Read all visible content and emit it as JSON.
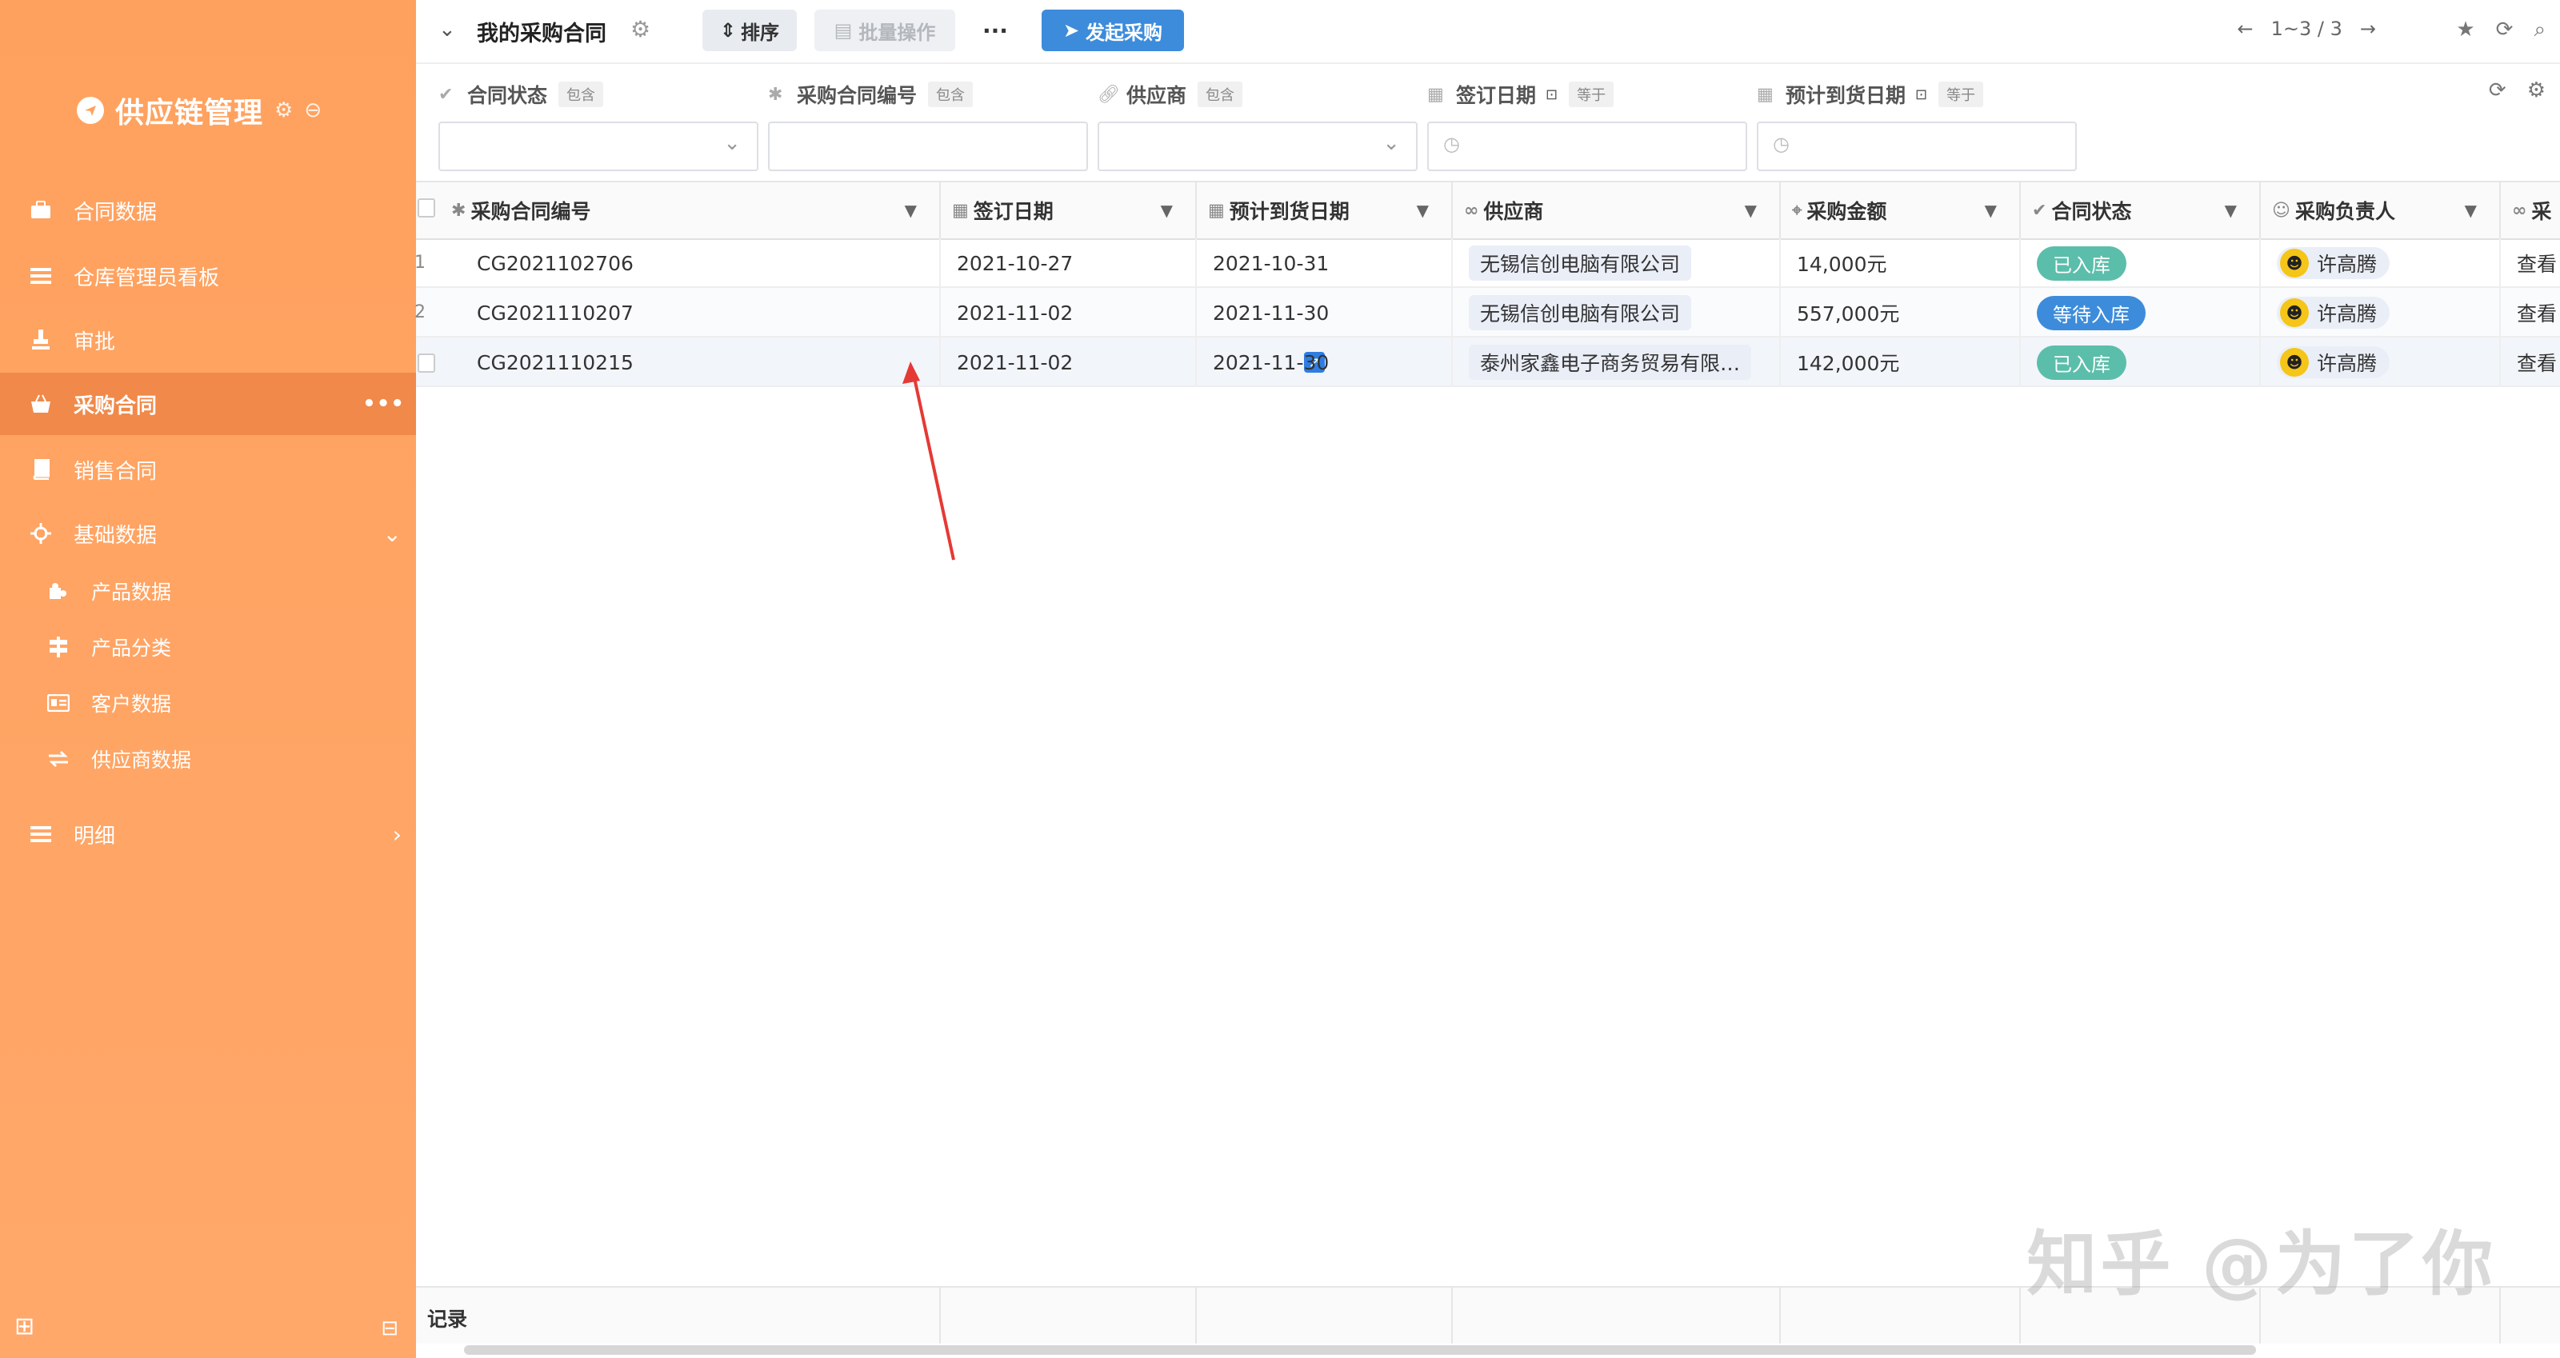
{
  "sidebar": {
    "brand": "供应链管理",
    "items": [
      {
        "label": "合同数据",
        "icon": "briefcase-icon"
      },
      {
        "label": "仓库管理员看板",
        "icon": "list-icon"
      },
      {
        "label": "审批",
        "icon": "stamp-icon"
      },
      {
        "label": "采购合同",
        "icon": "basket-icon",
        "active": true
      },
      {
        "label": "销售合同",
        "icon": "book-icon"
      },
      {
        "label": "基础数据",
        "icon": "crosshair-icon"
      }
    ],
    "sub_items": [
      {
        "label": "产品数据",
        "icon": "puzzle-icon"
      },
      {
        "label": "产品分类",
        "icon": "signpost-icon"
      },
      {
        "label": "客户数据",
        "icon": "id-card-icon"
      },
      {
        "label": "供应商数据",
        "icon": "swap-icon"
      }
    ],
    "detail": {
      "label": "明细",
      "icon": "list-icon"
    }
  },
  "toolbar": {
    "title": "我的采购合同",
    "sort_label": "排序",
    "batch_label": "批量操作",
    "more_label": "···",
    "launch_label": "发起采购",
    "pagination": "1~3 / 3"
  },
  "filters": [
    {
      "label": "合同状态",
      "op": "包含",
      "kind": "select"
    },
    {
      "label": "采购合同编号",
      "op": "包含",
      "kind": "text"
    },
    {
      "label": "供应商",
      "op": "包含",
      "kind": "select"
    },
    {
      "label": "签订日期",
      "op": "等于",
      "kind": "date"
    },
    {
      "label": "预计到货日期",
      "op": "等于",
      "kind": "date"
    }
  ],
  "table": {
    "columns": [
      "采购合同编号",
      "签订日期",
      "预计到货日期",
      "供应商",
      "采购金额",
      "合同状态",
      "采购负责人",
      "采"
    ],
    "rows": [
      {
        "num": "1",
        "code": "CG2021102706",
        "sign": "2021-10-27",
        "arrive": "2021-10-31",
        "supplier": "无锡信创电脑有限公司",
        "amount": "14,000元",
        "status": "已入库",
        "status_color": "#5bbeaa",
        "owner": "许高腾",
        "view": "查看"
      },
      {
        "num": "2",
        "code": "CG2021110207",
        "sign": "2021-11-02",
        "arrive": "2021-11-30",
        "supplier": "无锡信创电脑有限公司",
        "amount": "557,000元",
        "status": "等待入库",
        "status_color": "#3d8cdb",
        "owner": "许高腾",
        "view": "查看"
      },
      {
        "num": "",
        "code": "CG2021110215",
        "sign": "2021-11-02",
        "arrive": "2021-11-30",
        "supplier": "泰州家鑫电子商务贸易有限…",
        "amount": "142,000元",
        "status": "已入库",
        "status_color": "#5bbeaa",
        "owner": "许高腾",
        "view": "查看"
      }
    ],
    "footer_label": "记录"
  },
  "watermark": "知乎 @为了你",
  "colors": {
    "sidebar": "#ffa15e",
    "active": "#f0894a",
    "primary": "#3d8cdb",
    "green": "#5bbeaa",
    "annotation": "#e53935"
  }
}
